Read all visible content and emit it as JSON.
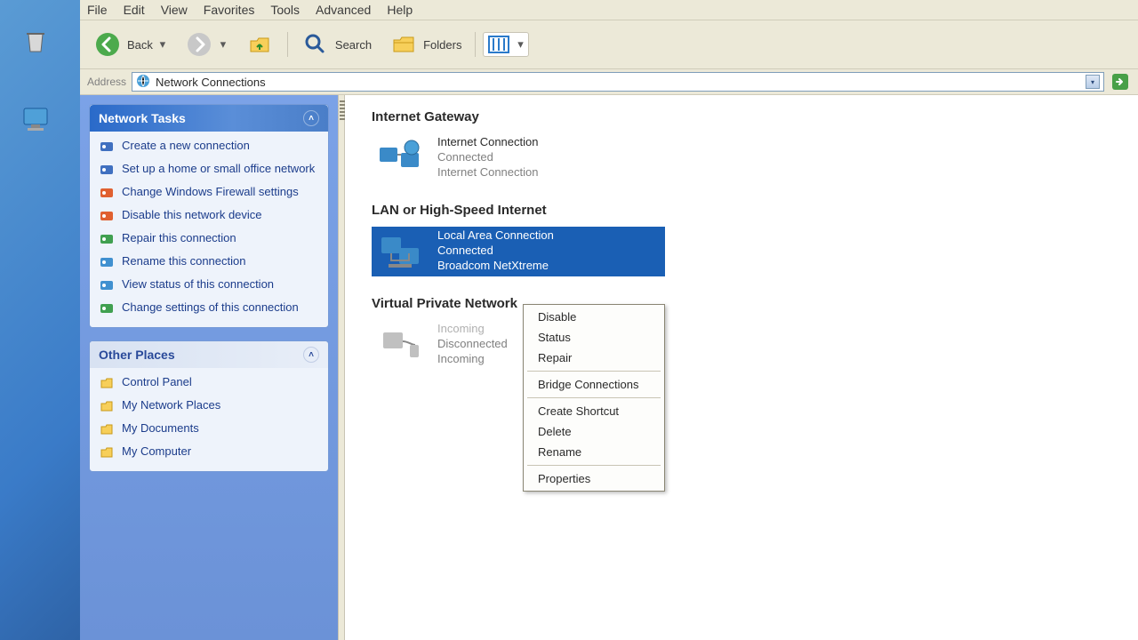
{
  "menubar": [
    "File",
    "Edit",
    "View",
    "Favorites",
    "Tools",
    "Advanced",
    "Help"
  ],
  "toolbar": {
    "back": "Back",
    "search": "Search",
    "folders": "Folders"
  },
  "address": {
    "label": "Address",
    "value": "Network Connections"
  },
  "panels": {
    "network_tasks": {
      "title": "Network Tasks",
      "items": [
        "Create a new connection",
        "Set up a home or small office network",
        "Change Windows Firewall settings",
        "Disable this network device",
        "Repair this connection",
        "Rename this connection",
        "View status of this connection",
        "Change settings of this connection"
      ]
    },
    "other_places": {
      "title": "Other Places",
      "items": [
        "Control Panel",
        "My Network Places",
        "My Documents",
        "My Computer"
      ]
    }
  },
  "content": {
    "groups": [
      {
        "title": "Internet Gateway",
        "connections": [
          {
            "name": "Internet Connection",
            "status": "Connected",
            "sub": "Internet Connection",
            "icon": "globe",
            "selected": false,
            "dimmed": false
          }
        ]
      },
      {
        "title": "LAN or High-Speed Internet",
        "connections": [
          {
            "name": "Local Area Connection",
            "status": "Connected",
            "sub": "Broadcom NetXtreme",
            "icon": "lan",
            "selected": true,
            "dimmed": false
          }
        ]
      },
      {
        "title": "Virtual Private Network",
        "connections": [
          {
            "name": "Incoming",
            "status": "Disconnected",
            "sub": "Incoming",
            "icon": "vpn",
            "selected": false,
            "dimmed": true
          }
        ]
      }
    ]
  },
  "context_menu": [
    "Disable",
    "Status",
    "Repair",
    "-",
    "Bridge Connections",
    "-",
    "Create Shortcut",
    "Delete",
    "Rename",
    "-",
    "Properties"
  ]
}
